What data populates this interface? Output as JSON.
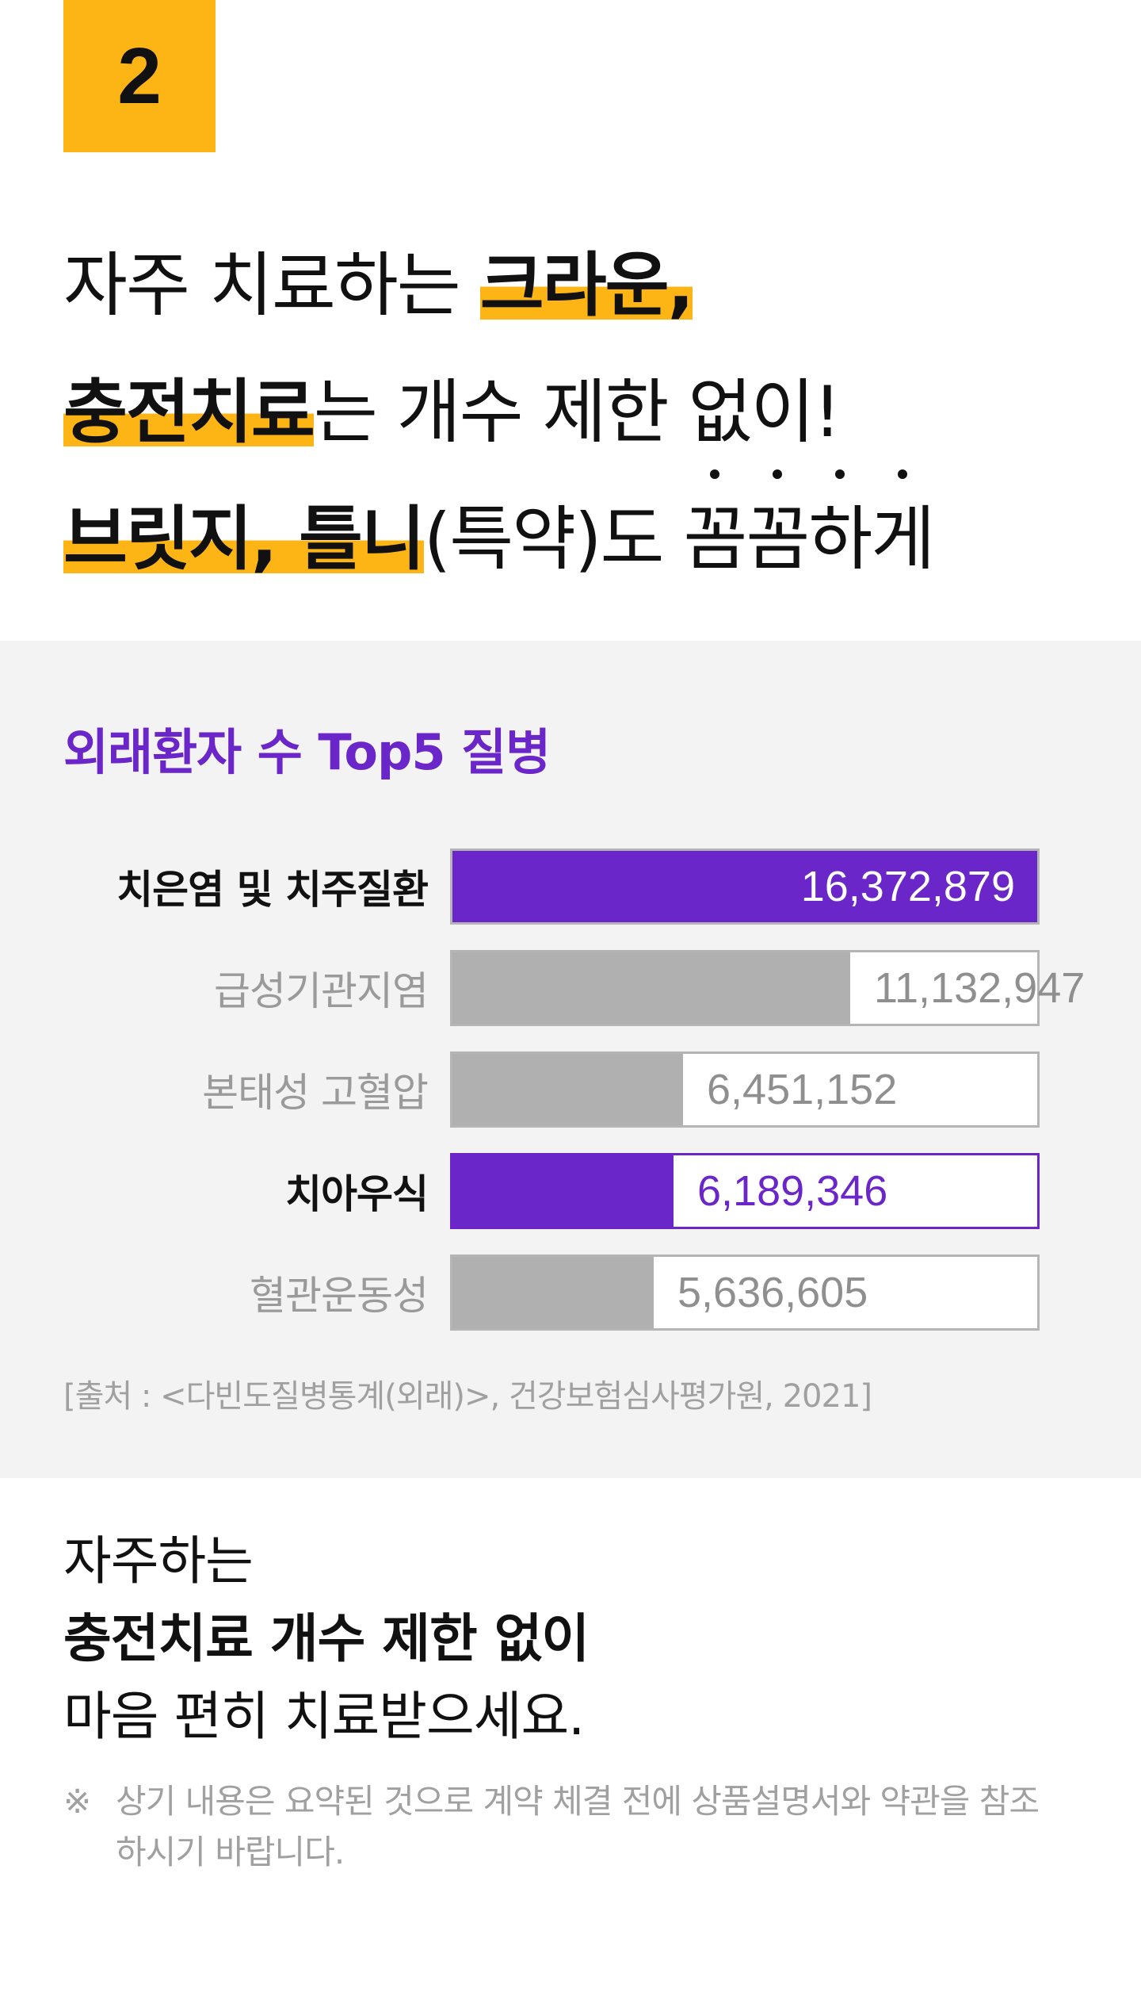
{
  "badge": "2",
  "headline": {
    "l1_plain": "자주 치료하는 ",
    "l1_hl": "크라운,",
    "l2_hl": "충전치료",
    "l2_plain": "는 개수 제한 없이!",
    "l3_hl": "브릿지, 틀니",
    "l3_plain1": "(특약)도 ",
    "l3_dot1": "꼼",
    "l3_dot2": "꼼",
    "l3_dot3": "하",
    "l3_dot4": "게"
  },
  "chart_data": {
    "type": "bar",
    "title": "외래환자 수 Top5 질병",
    "categories": [
      "치은염 및 치주질환",
      "급성기관지염",
      "본태성 고혈압",
      "치아우식",
      "혈관운동성"
    ],
    "values": [
      16372879,
      11132947,
      6451152,
      6189346,
      5636605
    ],
    "value_labels": [
      "16,372,879",
      "11,132,947",
      "6,451,152",
      "6,189,346",
      "5,636,605"
    ],
    "highlighted": [
      true,
      false,
      false,
      true,
      false
    ],
    "colors": {
      "highlight": "#6A26C8",
      "normal": "#B0B0B0",
      "track": "#FFFFFF"
    },
    "source": "[출처 : <다빈도질병통계(외래)>, 건강보험심사평가원, 2021]"
  },
  "bottom": {
    "line1": "자주하는",
    "line2": "충전치료 개수 제한 없이",
    "line3": "마음 편히 치료받으세요."
  },
  "note": {
    "mark": "※",
    "text": "상기 내용은 요약된 것으로 계약 체결 전에 상품설명서와 약관을 참조하시기 바랍니다."
  }
}
